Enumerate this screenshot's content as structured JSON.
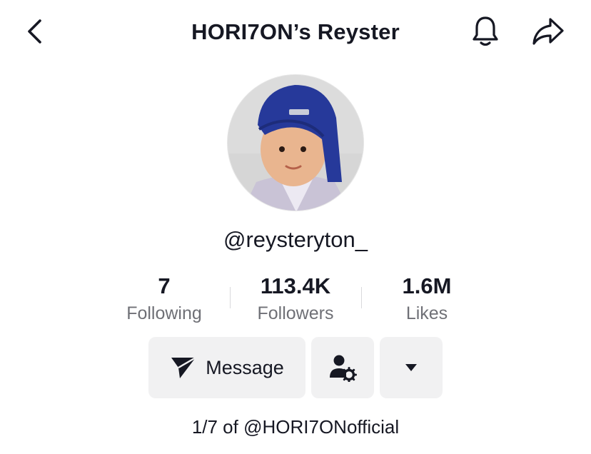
{
  "header": {
    "title": "HORI7ON’s Reyster",
    "back_icon": "chevron-left-icon",
    "bell_icon": "bell-icon",
    "share_icon": "share-arrow-icon"
  },
  "profile": {
    "username": "@reysteryton_",
    "bio": "1/7 of @HORI7ONofficial"
  },
  "stats": {
    "following": {
      "value": "7",
      "label": "Following"
    },
    "followers": {
      "value": "113.4K",
      "label": "Followers"
    },
    "likes": {
      "value": "1.6M",
      "label": "Likes"
    }
  },
  "actions": {
    "message_label": "Message",
    "message_icon": "send-icon",
    "friend_icon": "user-settings-icon",
    "more_icon": "caret-down-icon"
  },
  "colors": {
    "text": "#161823",
    "secondary_text": "#6f7076",
    "button_bg": "#f1f1f2"
  }
}
